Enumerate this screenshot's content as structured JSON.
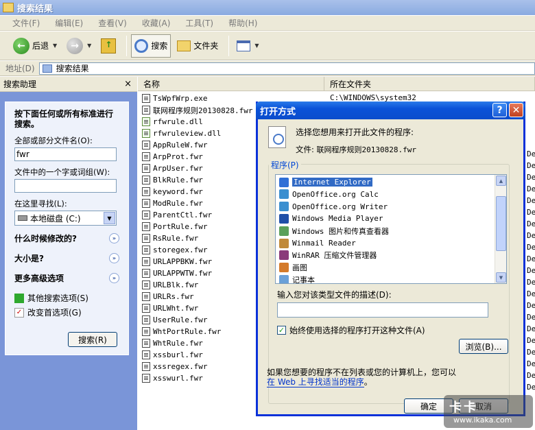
{
  "window": {
    "title": "搜索结果"
  },
  "menu": [
    "文件(F)",
    "编辑(E)",
    "查看(V)",
    "收藏(A)",
    "工具(T)",
    "帮助(H)"
  ],
  "toolbar": {
    "back": "后退",
    "search": "搜索",
    "folders": "文件夹"
  },
  "address": {
    "label": "地址(D)",
    "value": "搜索结果"
  },
  "search_pane": {
    "title": "搜索助理",
    "close": "×",
    "intro": "按下面任何或所有标准进行搜索。",
    "name_label": "全部或部分文件名(O):",
    "name_value": "fwr",
    "phrase_label": "文件中的一个字或词组(W):",
    "phrase_value": "",
    "look_in_label": "在这里寻找(L):",
    "look_in_value": "本地磁盘 (C:)",
    "when_modified": "什么时候修改的?",
    "size": "大小是?",
    "advanced": "更多高级选项",
    "other_options": "其他搜索选项(S)",
    "change_prefs": "改变首选项(G)",
    "search_button": "搜索(R)"
  },
  "file_list": {
    "columns": [
      "名称",
      "所在文件夹"
    ],
    "first_folder": "C:\\WINDOWS\\system32",
    "trailing_char": "De",
    "files": [
      {
        "name": "TsWpfWrp.exe",
        "type": "exe"
      },
      {
        "name": "联网程序规则20130828.fwr",
        "type": "fwr"
      },
      {
        "name": "rfwrule.dll",
        "type": "dll"
      },
      {
        "name": "rfwruleview.dll",
        "type": "dll"
      },
      {
        "name": "AppRuleW.fwr",
        "type": "fwr"
      },
      {
        "name": "ArpProt.fwr",
        "type": "fwr"
      },
      {
        "name": "ArpUser.fwr",
        "type": "fwr"
      },
      {
        "name": "BlkRule.fwr",
        "type": "fwr"
      },
      {
        "name": "keyword.fwr",
        "type": "fwr"
      },
      {
        "name": "ModRule.fwr",
        "type": "fwr"
      },
      {
        "name": "ParentCtl.fwr",
        "type": "fwr"
      },
      {
        "name": "PortRule.fwr",
        "type": "fwr"
      },
      {
        "name": "RsRule.fwr",
        "type": "fwr"
      },
      {
        "name": "storegex.fwr",
        "type": "fwr"
      },
      {
        "name": "URLAPPBKW.fwr",
        "type": "fwr"
      },
      {
        "name": "URLAPPWTW.fwr",
        "type": "fwr"
      },
      {
        "name": "URLBlk.fwr",
        "type": "fwr"
      },
      {
        "name": "URLRs.fwr",
        "type": "fwr"
      },
      {
        "name": "URLWht.fwr",
        "type": "fwr"
      },
      {
        "name": "UserRule.fwr",
        "type": "fwr"
      },
      {
        "name": "WhtPortRule.fwr",
        "type": "fwr"
      },
      {
        "name": "WhtRule.fwr",
        "type": "fwr"
      },
      {
        "name": "xssburl.fwr",
        "type": "fwr"
      },
      {
        "name": "xssregex.fwr",
        "type": "fwr"
      },
      {
        "name": "xsswurl.fwr",
        "type": "fwr"
      }
    ]
  },
  "dialog": {
    "title": "打开方式",
    "help": "?",
    "close": "✕",
    "prompt": "选择您想用来打开此文件的程序:",
    "file_label": "文件:",
    "file_name": "联网程序规则20130828.fwr",
    "programs_label": "程序(P)",
    "programs": [
      {
        "name": "Internet Explorer",
        "color": "#2f6fd6",
        "selected": true
      },
      {
        "name": "OpenOffice.org Calc",
        "color": "#3b8fd0",
        "selected": false
      },
      {
        "name": "OpenOffice.org Writer",
        "color": "#3b8fd0",
        "selected": false
      },
      {
        "name": "Windows Media Player",
        "color": "#1e4fa8",
        "selected": false
      },
      {
        "name": "Windows 图片和传真查看器",
        "color": "#5aa05a",
        "selected": false
      },
      {
        "name": "Winmail Reader",
        "color": "#c08a3a",
        "selected": false
      },
      {
        "name": "WinRAR 压缩文件管理器",
        "color": "#8a3a7a",
        "selected": false
      },
      {
        "name": "画图",
        "color": "#d47a2a",
        "selected": false
      },
      {
        "name": "记事本",
        "color": "#6aa0d8",
        "selected": false
      }
    ],
    "desc_label": "输入您对该类型文件的描述(D):",
    "desc_value": "",
    "always_use": "始终使用选择的程序打开这种文件(A)",
    "always_use_checked": true,
    "browse": "浏览(B)...",
    "note_line1": "如果您想要的程序不在列表或您的计算机上，您可以",
    "note_link": "在 Web 上寻找适当的程序",
    "note_end": "。",
    "ok": "确定",
    "cancel": "取消"
  },
  "watermark": {
    "line1": "卡卡",
    "line2": "www.ikaka.com"
  }
}
